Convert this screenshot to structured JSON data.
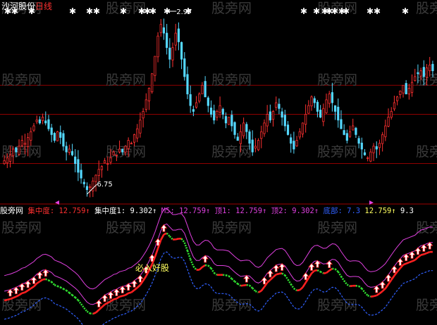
{
  "header": {
    "stock_name": "沙河股份",
    "period": "日线"
  },
  "price_chart": {
    "type": "candlestick",
    "high_marker": "2.97",
    "low_marker": "6.75",
    "up_color": "#ff3030",
    "down_color": "#54d8ff",
    "guide_levels": [
      10.5,
      9.5,
      7.8
    ]
  },
  "indicator_bar": {
    "panel_name": "股旁网",
    "items": [
      {
        "label": "集中度:",
        "value": "12.759↑",
        "label_color": "#ff3030",
        "value_color": "#ff3030"
      },
      {
        "label": "集中度1:",
        "value": "9.302↑",
        "label_color": "#ffffff",
        "value_color": "#ffffff"
      },
      {
        "label": "M5:",
        "value": "12.759↑",
        "label_color": "#e040e0",
        "value_color": "#e040e0"
      },
      {
        "label": "顶1:",
        "value": "12.759↑",
        "label_color": "#e040e0",
        "value_color": "#e040e0"
      },
      {
        "label": "顶2:",
        "value": "9.302↑",
        "label_color": "#e040e0",
        "value_color": "#e040e0"
      },
      {
        "label": "底部:",
        "value": "7.3",
        "label_color": "#3060ff",
        "value_color": "#3060ff"
      },
      {
        "label": "",
        "value": "12.759↑",
        "label_color": "#ffff60",
        "value_color": "#ffff60"
      },
      {
        "label": "",
        "value": "9.3",
        "label_color": "#ffffff",
        "value_color": "#ffffff"
      }
    ]
  },
  "signal_label": "必入好股",
  "watermark": "股旁网",
  "chart_data": {
    "type": "candlestick",
    "title": "沙河股份 日线",
    "price_range": [
      6.6,
      13.2
    ],
    "max_price": 12.97,
    "min_price": 6.75,
    "close_series": [
      7.9,
      8.0,
      8.1,
      8.3,
      8.2,
      8.4,
      8.6,
      8.5,
      8.7,
      8.9,
      9.1,
      9.3,
      9.2,
      9.4,
      9.2,
      9.0,
      8.8,
      8.6,
      8.9,
      8.7,
      8.4,
      8.2,
      8.3,
      8.1,
      7.8,
      7.5,
      7.3,
      7.1,
      6.9,
      7.0,
      7.2,
      7.4,
      7.6,
      7.7,
      7.9,
      7.8,
      8.0,
      8.2,
      8.1,
      8.3,
      8.2,
      8.4,
      8.6,
      8.5,
      8.8,
      9.0,
      9.3,
      9.6,
      10.0,
      10.4,
      10.9,
      11.5,
      12.2,
      12.6,
      12.3,
      11.8,
      11.4,
      11.8,
      12.3,
      12.0,
      11.4,
      10.8,
      10.2,
      9.8,
      9.6,
      9.9,
      10.2,
      10.5,
      10.1,
      9.8,
      9.5,
      9.3,
      9.6,
      9.8,
      9.5,
      9.2,
      9.4,
      9.1,
      8.8,
      8.6,
      8.9,
      9.2,
      8.9,
      8.5,
      8.2,
      8.4,
      8.6,
      8.9,
      9.2,
      9.5,
      9.3,
      9.6,
      9.9,
      9.7,
      9.4,
      9.1,
      8.8,
      8.5,
      8.3,
      8.6,
      8.9,
      9.2,
      9.5,
      9.8,
      10.1,
      9.9,
      9.6,
      9.4,
      9.7,
      10.0,
      10.2,
      9.9,
      9.6,
      9.3,
      9.0,
      8.8,
      8.6,
      8.9,
      9.1,
      8.8,
      8.5,
      8.3,
      8.1,
      8.0,
      8.2,
      8.4,
      8.3,
      8.5,
      8.8,
      9.1,
      9.4,
      9.6,
      9.9,
      10.1,
      10.3,
      10.5,
      10.2,
      10.4,
      10.6,
      10.8,
      10.9,
      11.0,
      10.8,
      11.1,
      11.2,
      11.0
    ],
    "signal_markers": "top row stars marking sell/hold signals",
    "indicator": {
      "name": "股旁网",
      "series": [
        {
          "name": "集中度",
          "last_value": 12.759
        },
        {
          "name": "集中度1",
          "last_value": 9.302
        },
        {
          "name": "M5",
          "last_value": 12.759
        },
        {
          "name": "顶1",
          "last_value": 12.759
        },
        {
          "name": "顶2",
          "last_value": 9.302
        },
        {
          "name": "底部",
          "last_value": 7.3
        }
      ]
    }
  }
}
